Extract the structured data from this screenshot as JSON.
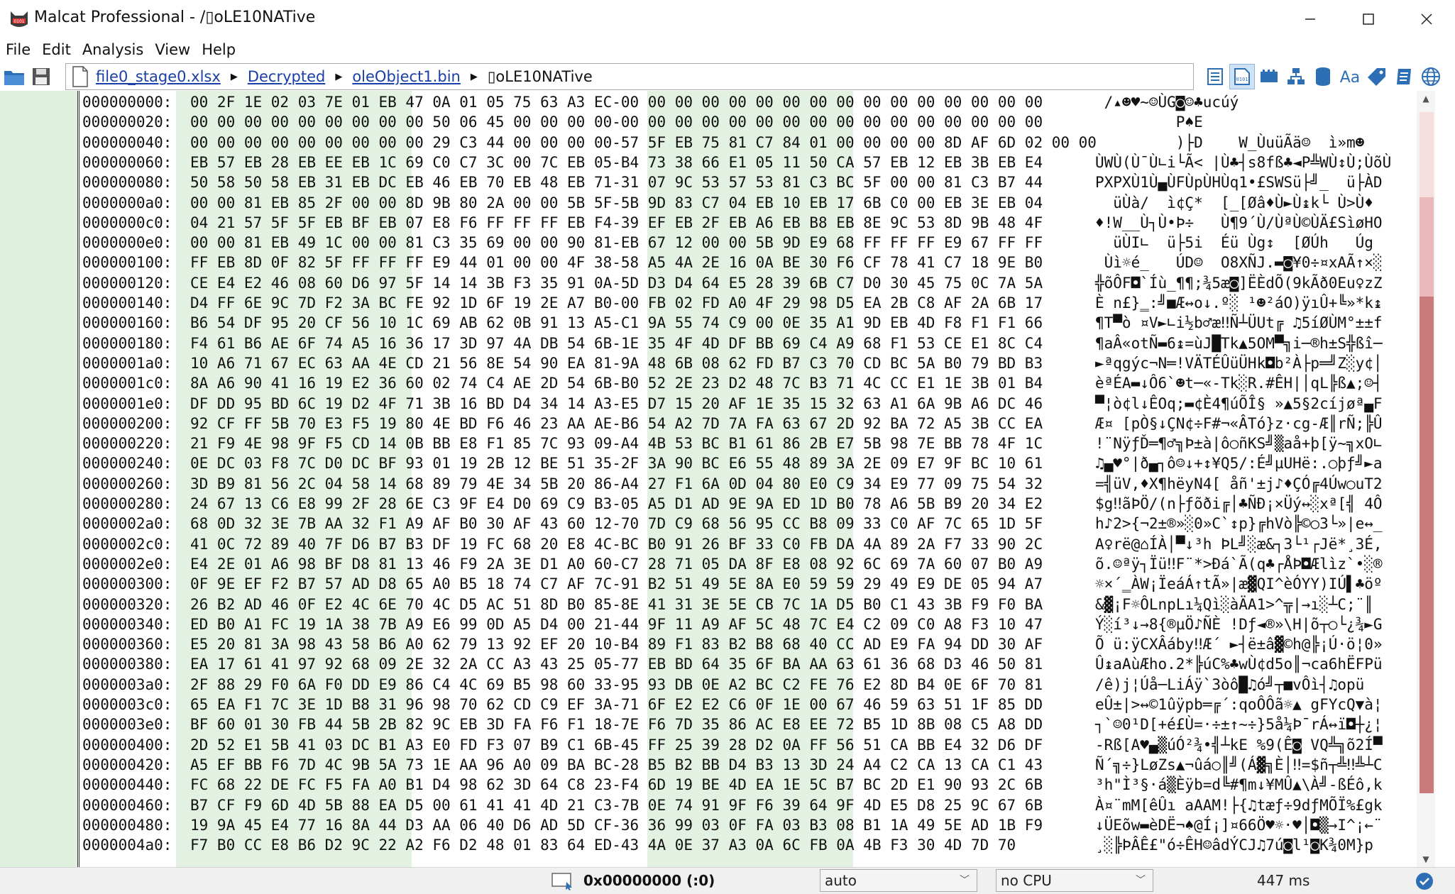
{
  "window": {
    "title": "Malcat Professional - /▯oLE10NATive",
    "colors": {
      "accent": "#1a3fa6",
      "gutter": "#dff0df",
      "band": "#e2f1e2",
      "minimap": "#c97b7b"
    }
  },
  "menu": [
    "File",
    "Edit",
    "Analysis",
    "View",
    "Help"
  ],
  "breadcrumb": {
    "items": [
      "file0_stage0.xlsx",
      "Decrypted",
      "oleObject1.bin",
      "▯oLE10NATive"
    ]
  },
  "hexview": {
    "rows": [
      {
        "a": "000000000:",
        "h": "00 2F 1E 02 03 7E 01 EB 47 0A 01 05 75 63 A3 EC-00 00 00 00 00 00 00 00 00 00 00 00 00 00 00 00",
        "t": " /▴☻♥~☺ÙG◙☺♣ucúý"
      },
      {
        "a": "000000020:",
        "h": "00 00 00 00 00 00 00 00 00 50 06 45 00 00 00 00-00 00 00 00 00 00 00 00 00 00 00 00 00 00 00 00",
        "t": "         P♠E"
      },
      {
        "a": "000000040:",
        "h": "00 00 00 00 00 00 00 00 00 29 C3 44 00 00 00 00-57 5F EB 75 81 C7 84 01 00 00 00 00 8D AF 6D 02 00 00",
        "t": "         )├D    W_ÙuüÃä☺  ì»m☻"
      },
      {
        "a": "000000060:",
        "h": "EB 57 EB 28 EB EE EB 1C 69 C0 C7 3C 00 7C EB 05-B4 73 38 66 E1 05 11 50 CA 57 EB 12 EB 3B EB E4",
        "t": "ÙWÙ(Ù¯Ù∟i└Ã< |Ù♣┤s8fß♣◄P╩WÙ↕Ù;ÙõÙ"
      },
      {
        "a": "000000080:",
        "h": "50 58 50 58 EB 31 EB DC EB 46 EB 70 EB 48 EB 71-31 07 9C 53 57 53 81 C3 BC 5F 00 00 81 C3 B7 44",
        "t": "PXPXÙ1Ù▄ÙFÙpÙHÙq1•£SWSü├╝_  ü├ÀD"
      },
      {
        "a": "0000000a0:",
        "h": "00 00 81 EB 85 2F 00 00 8D 9B 80 2A 00 00 5B 5F-5B 9D 83 C7 04 EB 10 EB 17 6B C0 00 EB 3E EB 04",
        "t": "  üÙà/  ì¢Ç*  [_[Øâ♦Ù►Ù↨k└ Ù>Ù♦"
      },
      {
        "a": "0000000c0:",
        "h": "04 21 57 5F 5F EB BF EB 07 E8 F6 FF FF FF EB F4-39 EF EB 2F EB A6 EB B8 EB 8E 9C 53 8D 9B 48 4F",
        "t": "♦!W__Ù┐Ù•Þ÷   Ù¶9´Ù/ÙªÙ©ÙÄ£SìøHO"
      },
      {
        "a": "0000000e0:",
        "h": "00 00 81 EB 49 1C 00 00 81 C3 35 69 00 00 90 81-EB 67 12 00 00 5B 9D E9 68 FF FF FF E9 67 FF FF",
        "t": "  üÙI∟  ü├5i  Éü Ùg↕  [ØÚh   Úg  "
      },
      {
        "a": "000000100:",
        "h": "FF EB 8D 0F 82 5F FF FF FF E9 44 01 00 00 4F 38-58 A5 4A 2E 16 0A BE 30 F6 CF 78 41 C7 18 9E B0",
        "t": " Ùì☼é_   ÚD☺  O8XÑJ.▬◙¥0÷¤xAÃ↑×░"
      },
      {
        "a": "000000120:",
        "h": "CE E4 E2 46 08 60 D6 97 5F 14 14 3B F3 35 91 0A-5D D3 D4 64 E5 28 39 6B C7 D0 30 45 75 0C 7A 5A",
        "t": "╬õÔF◘`Íù_¶¶;¾5æ◙]ËÈdÕ(9kÃð0Eu♀zZ"
      },
      {
        "a": "000000140:",
        "h": "D4 FF 6E 9C 7D F2 3A BC FE 92 1D 6F 19 2E A7 B0-00 FB 02 FD A0 4F 29 98 D5 EA 2B C8 AF 2A 6B 17",
        "t": "È n£}‗:╝■Æ↔o↓.º░ ¹☻²áO)ÿıÛ+╚»*k↨"
      },
      {
        "a": "000000160:",
        "h": "B6 54 DF 95 20 CF 56 10 1C 69 AB 62 0B 91 13 A5-C1 9A 55 74 C9 00 0E 35 A1 9D EB 4D F8 F1 F1 66",
        "t": "¶T▀ò ¤V►∟i½b♂æ‼Ñ┴ÜUt╔ ♫5íØÙM°±±f"
      },
      {
        "a": "000000180:",
        "h": "F4 61 B6 AE 6F 74 A5 16 36 17 3D 97 4A DB 54 6B-1E 35 4F 4D DF BB 69 C4 A9 68 F1 53 CE E1 8C C4",
        "t": "¶aÂ«otÑ▬6↨=ùJ█Tk▲5OM▀╗i─®h±S╬ßî─"
      },
      {
        "a": "0000001a0:",
        "h": "10 A6 71 67 EC 63 AA 4E CD 21 56 8E 54 90 EA 81-9A 48 6B 08 62 FD B7 C3 70 CD BC 5A B0 79 BD B3",
        "t": "►ªqgýc¬N═!VÄTÉÛüÜHk◘b²À├p═╝Z░y¢│"
      },
      {
        "a": "0000001c0:",
        "h": "8A A6 90 41 16 19 E2 36 60 02 74 C4 AE 2D 54 6B-B0 52 2E 23 D2 48 7C B3 71 4C CC E1 1E 3B 01 B4",
        "t": "èªÉA▬↓Ô6`☻t─«-Tk░R.#ÊH|│qL╠ß▲;☺┤"
      },
      {
        "a": "0000001e0:",
        "h": "DF DD 95 BD 6C 19 D2 4F 71 3B 16 BD D4 34 14 A3-E5 D7 15 20 AF 1E 35 15 32 63 A1 6A 9B A6 DC 46",
        "t": "▀¦ò¢l↓ÊOq;▬¢È4¶úÕÎ§ »▲5§2cíjøª▄F"
      },
      {
        "a": "000000200:",
        "h": "92 CF FF 5B 70 E3 F5 19 80 4E BD F6 46 23 AA AE-B6 54 A2 7D 7A FA 63 67 2D 92 BA 72 A5 3B CC EA",
        "t": "Æ¤ [pÒ§↓ÇN¢÷F#¬«ÂTó}z·cg-Æ║rÑ;╠Û"
      },
      {
        "a": "000000220:",
        "h": "21 F9 4E 98 9F F5 CD 14 0B BB E8 F1 85 7C 93 09-A4 4B 53 BC B1 61 86 2B E7 5B 98 7E BB 78 4F 1C",
        "t": "!¨NÿƒĎ═¶♂╗Þ±à|ô○ñKS╝▒aå+þ[ÿ~╗xO∟"
      },
      {
        "a": "000000240:",
        "h": "0E DC 03 F8 7C D0 DC BF 93 01 19 2B 12 BE 51 35-2F 3A 90 BC E6 55 48 89 3A 2E 09 E7 9F BC 10 61",
        "t": "♫▄♥°|ð▄┐ô☺↓+↕¥Q5/:É╝µUHë:.○þƒ╝►a"
      },
      {
        "a": "000000260:",
        "h": "3D B9 81 56 2C 04 58 14 68 89 79 4E 34 5B 20 86-A4 27 F1 6A 0D 04 80 E0 C9 34 E9 77 09 75 54 32",
        "t": "=╣üV,♦X¶hëyN4[ åñ'±j♪♦ÇÓ╔4Úw○uT2"
      },
      {
        "a": "000000280:",
        "h": "24 67 13 C6 E8 99 2F 28 6E C3 9F E4 D0 69 C9 B3-05 A5 D1 AD 9E 9A ED 1D B0 78 A6 5B B9 20 34 E2",
        "t": "$g‼ãÞÖ/(n├ƒõði╔│♣ÑÐ¡×Üý↔░xª[╣ 4Ô"
      },
      {
        "a": "0000002a0:",
        "h": "68 0D 32 3E 7B AA 32 F1 A9 AF B0 30 AF 43 60 12-70 7D C9 68 56 95 CC B8 09 33 C0 AF 7C 65 1D 5F",
        "t": "h♪2>{¬2±®»░0»C`↕p}╔hVò╠©○3└»|e↔_"
      },
      {
        "a": "0000002c0:",
        "h": "41 0C 72 89 40 7F D6 B7 B3 DF 19 FC 68 20 E8 4C-BC B0 91 26 BF 33 C0 FB DA 4A 89 2A F7 33 90 2C",
        "t": "A♀rë@⌂ÍÀ│▀↓³h ÞL╝░æ&┐3└¹┌Jë*¸3É,"
      },
      {
        "a": "0000002e0:",
        "h": "E4 2E 01 A6 98 BF D8 81 13 46 F9 2A 3E D1 A0 60-C7 28 71 05 DA 8F E8 08 92 6C 69 7A 60 07 B0 A9",
        "t": "õ.☺ªÿ┐Ïü‼F¨*>Ðá`Ã(q♣┌ÅÞ◘Ælìz`•░®"
      },
      {
        "a": "000000300:",
        "h": "0F 9E EF F2 B7 57 AD D8 65 A0 B5 18 74 C7 AF 7C-91 B2 51 49 5E 8A E0 59 59 29 49 E9 DE 05 94 A7",
        "t": "☼×´‗ÀW¡ÏeáÁ↑tÃ»|æ▓QI^èÓYY)IÚ▌♣öº"
      },
      {
        "a": "000000320:",
        "h": "26 B2 AD 46 0F E2 4C 6E 70 4C D5 AC 51 8D B0 85-8E 41 31 3E 5E CB 7C 1A D5 B0 C1 43 3B F9 F0 BA",
        "t": "&▓¡F☼ÔLnpLı¼Qì░àÄA1>^╦|→ı░┴C;¨­║"
      },
      {
        "a": "000000340:",
        "h": "ED B0 A1 FC 19 1A 38 7B A9 E6 99 0D A5 D4 00 21-44 9F 11 A9 AF 5C 48 7C E4 C2 09 C0 A8 F3 10 47",
        "t": "Ý░í³↓→8{®µÖ♪ÑÈ !Dƒ◄®»\\H|õ┬○└¿¾►G"
      },
      {
        "a": "000000360:",
        "h": "E5 20 81 3A 98 43 58 B6 A0 62 79 13 92 EF 20 10-B4 89 F1 83 B2 B8 68 40 CC AD E9 FA 94 DD 30 AF",
        "t": "Õ ü:ÿCXÂáby‼Æ´ ►┤ë±â▓©h@╠¡Ú·ö¦0»"
      },
      {
        "a": "000000380:",
        "h": "EA 17 61 41 97 92 68 09 2E 32 2A CC A3 43 25 05-77 EB BD 64 35 6F BA AA 63 61 36 68 D3 46 50 81",
        "t": "Û↨aAùÆho.2*╠úC%♣wÙ¢d5o║¬ca6hËFPü"
      },
      {
        "a": "0000003a0:",
        "h": "2F 88 29 F0 6A F0 DD E9 86 C4 4C 69 B5 98 60 33-95 93 DB 0E A2 BC C2 FE 76 E2 8D B4 0E 6F 70 81",
        "t": "/ê)­j­¦Úå─LiÁÿ`3òô█♫ó╝┬■vÔì┤♫opü"
      },
      {
        "a": "0000003c0:",
        "h": "65 EA F1 7C 3E 1D B8 31 96 98 70 62 CD C9 EF 3A-71 6F E2 E2 C6 0F 1E 00 67 46 59 63 51 1F 85 DD",
        "t": "eÛ±|>↔©1ûÿpb═╔´:qoÔÔã☼▲ gFYcQ▼à¦"
      },
      {
        "a": "0000003e0:",
        "h": "BF 60 01 30 FB 44 5B 2B 82 9C EB 3D FA F6 F1 18-7E F6 7D 35 86 AC E8 EE 72 B5 1D 8B 08 C5 A8 DD",
        "t": "┐`☺0¹D[+é£Ù=·÷±↑~÷}5å¼Þ¯rÁ↔ï◘┼¿¦"
      },
      {
        "a": "000000400:",
        "h": "2D 52 E1 5B 41 03 DC B1 A3 E0 FD F3 07 B9 C1 6B-45 FF 25 39 28 D2 0A FF 56 51 CA BB E4 32 D6 DF",
        "t": "-Rß[A♥▄▒úÓ²¾•╣┴kE %9(Ê◙ VQ╩╗õ2Í▀"
      },
      {
        "a": "000000420:",
        "h": "A5 EF BB F6 7D 4C 9B 5A 73 1E AA 96 A0 09 BA BC-28 B5 B2 BB D4 B3 13 3D 24 A4 C2 CA 13 CA C1 43",
        "t": "Ñ´╗÷}LøZs▲¬ûá○║╝(Á▓╗È│‼=$ñ┬╩‼╩┴C"
      },
      {
        "a": "000000440:",
        "h": "FC 68 22 DE FC F5 FA A0 B1 D4 98 62 3D 64 C8 23-F4 6D 19 BE 4D EA 1E 5C B7 BC 2D E1 90 93 2C 6B",
        "t": "³h\"Ì³§·á▒Èÿb=d╚#¶m↓¥MÛ▲\\À╝-ßÉô,k"
      },
      {
        "a": "000000460:",
        "h": "B7 CF F9 6D 4D 5B 88 EA D5 00 61 41 41 4D 21 C3-7B 0E 74 91 9F F6 39 64 9F 4D E5 D8 25 9C 67 6B",
        "t": "À¤¨mM[êÛı aAAM!├{♫tæƒ÷9dƒMÕÏ%£gk"
      },
      {
        "a": "000000480:",
        "h": "19 9A 45 E4 77 16 8A 44 D3 AA 06 40 D6 AD 5D CF-36 36 99 03 0F FA 03 B3 08 B1 1A 49 5E AD 1B F9",
        "t": "↓ÜEõw▬èDË¬♠@Í¡]¤66Ö♥☼·♥│◘▒→I^¡←¨"
      },
      {
        "a": "0000004a0:",
        "h": "F7 B0 CC E8 B6 D2 9C 22 A2 F6 D2 48 01 83 64 ED-43 4A 0E 37 A3 0A 6C FB 0A 4B F3 30 4D 7D 70",
        "t": "¸░╠ÞÂÊ£\"ó÷ÊH☺âdÝCJ♫7ú◙l¹◙K¾0M}p"
      }
    ]
  },
  "status": {
    "address": "0x00000000 (:0)",
    "mode": "auto",
    "cpu": "no CPU",
    "timing": "447 ms"
  }
}
